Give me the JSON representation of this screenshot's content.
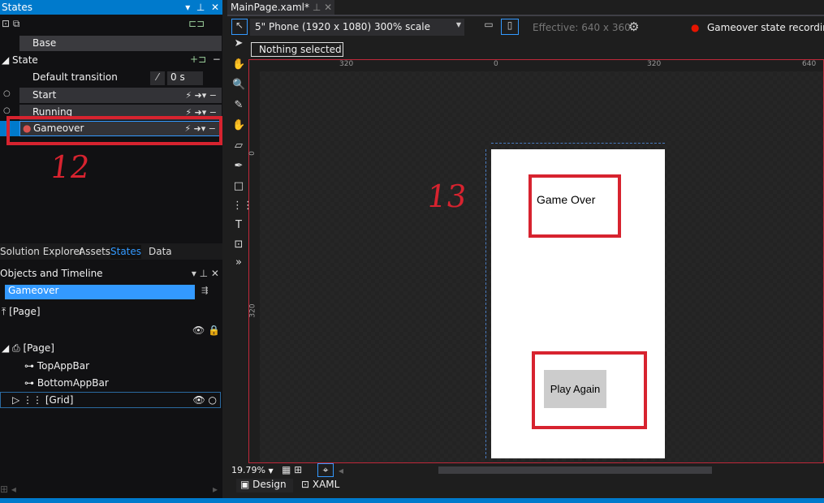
{
  "states_panel": {
    "title": "States",
    "base": "Base",
    "group": "State",
    "default_transition": "Default transition",
    "transition_time": "0 s",
    "states": [
      "Start",
      "Running",
      "Gameover"
    ]
  },
  "bottom_tabs": [
    "Solution Explorer",
    "Assets",
    "States",
    "Data"
  ],
  "objects_panel": {
    "title": "Objects and Timeline",
    "scope": "Gameover",
    "page_root": "[Page]",
    "tree": {
      "page": "[Page]",
      "items": [
        "TopAppBar",
        "BottomAppBar"
      ],
      "grid": "[Grid]"
    }
  },
  "editor": {
    "tab": "MainPage.xaml*",
    "device": "5\" Phone (1920 x 1080) 300% scale",
    "effective": "Effective: 640 x 360",
    "recording": "Gameover state recording is",
    "selection": "Nothing selected",
    "ruler_top": [
      "320",
      "0",
      "320",
      "640"
    ],
    "ruler_left": [
      "0",
      "320"
    ],
    "zoom": "19.79%",
    "view_tabs": [
      "Design",
      "XAML"
    ]
  },
  "phone": {
    "title": "Game Over",
    "button": "Play Again"
  },
  "annotations": [
    "12",
    "13"
  ],
  "colors": {
    "accent": "#007acc",
    "recording": "#e51400",
    "highlight": "#d7232f"
  }
}
